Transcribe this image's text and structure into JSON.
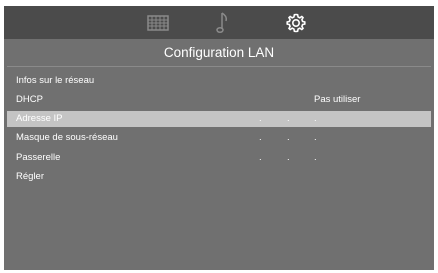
{
  "tabs": [
    {
      "icon": "grid-icon",
      "active": false
    },
    {
      "icon": "music-note-icon",
      "active": false
    },
    {
      "icon": "gear-icon",
      "active": true
    }
  ],
  "panel": {
    "title": "Configuration LAN"
  },
  "menu": {
    "network_info": {
      "label": "Infos sur le réseau"
    },
    "dhcp": {
      "label": "DHCP",
      "value": "Pas utiliser"
    },
    "ip_address": {
      "label": "Adresse IP",
      "separators": [
        ".",
        ".",
        "."
      ]
    },
    "subnet_mask": {
      "label": "Masque de sous-réseau",
      "separators": [
        ".",
        ".",
        "."
      ]
    },
    "gateway": {
      "label": "Passerelle",
      "separators": [
        ".",
        ".",
        "."
      ]
    },
    "apply": {
      "label": "Régler"
    }
  },
  "colors": {
    "background": "#707070",
    "topbar": "#4b4b4b",
    "selected_row": "#c4c4c4",
    "text": "#ffffff"
  }
}
